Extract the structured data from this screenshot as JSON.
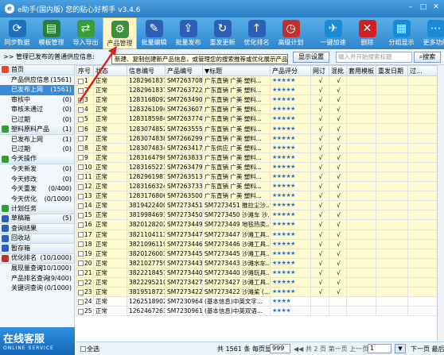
{
  "window": {
    "title": "e助手(国内版) 您的贴心好帮手 v3.4.6",
    "min": "–",
    "max": "□",
    "close": "✕"
  },
  "toolbar": [
    {
      "label": "同步数据",
      "color": "#1d6fc0",
      "glyph": "⟳"
    },
    {
      "label": "模板管理",
      "color": "#2a7d3a",
      "glyph": "▤"
    },
    {
      "label": "导入导出",
      "color": "#3a9b3a",
      "glyph": "⇄"
    },
    {
      "label": "产品管理",
      "color": "#3c8f3c",
      "glyph": "⚙"
    },
    {
      "label": "批量编辑",
      "color": "#2d5fb8",
      "glyph": "✎"
    },
    {
      "label": "批量发布",
      "color": "#2d5fb8",
      "glyph": "⇪"
    },
    {
      "label": "重发更新",
      "color": "#2d5fb8",
      "glyph": "↻"
    },
    {
      "label": "优化排名",
      "color": "#2d5fb8",
      "glyph": "↑"
    },
    {
      "label": "高级计划",
      "color": "#c03030",
      "glyph": "◷"
    },
    {
      "label": "一键加速",
      "color": "#1a8ad6",
      "glyph": "✈"
    },
    {
      "label": "删除",
      "color": "#d02020",
      "glyph": "✕"
    },
    {
      "label": "分组显示",
      "color": "#1a8ad6",
      "glyph": "▦"
    },
    {
      "label": "更多功能",
      "color": "#1a8ad6",
      "glyph": "⋯"
    }
  ],
  "infobar": {
    "text": ">> 管理已发布的普通供应信息:",
    "show_settings": "显示设置",
    "search_placeholder": "输入并开始搜索标题",
    "search_button": "搜索"
  },
  "tooltip": "新建、复制创建新产品信息，或管理您的搜索推荐或优化展示产品信息",
  "sidebar": [
    {
      "label": "首页",
      "type": "group",
      "count": "",
      "color": "#e24a2a"
    },
    {
      "label": "产品供应信息",
      "type": "sub",
      "count": "(1561)"
    },
    {
      "label": "已发布上网",
      "type": "sub",
      "count": "(1561)",
      "selected": true
    },
    {
      "label": "审核中",
      "type": "sub",
      "count": "(0)"
    },
    {
      "label": "审核未通过",
      "type": "sub",
      "count": "(0)"
    },
    {
      "label": "已过期",
      "type": "sub",
      "count": "(0)"
    },
    {
      "label": "塑料原料产品",
      "type": "group",
      "count": "(1)",
      "color": "#3a9b3a"
    },
    {
      "label": "已发布上网",
      "type": "sub",
      "count": "(1)"
    },
    {
      "label": "已过期",
      "type": "sub",
      "count": "(0)"
    },
    {
      "label": "今天操作",
      "type": "group",
      "count": "",
      "color": "#3a9b3a"
    },
    {
      "label": "今天新发",
      "type": "sub",
      "count": "(0)"
    },
    {
      "label": "今天修改",
      "type": "sub",
      "count": "(0)"
    },
    {
      "label": "今天重发",
      "type": "sub",
      "count": "(0/400)"
    },
    {
      "label": "今天优化",
      "type": "sub",
      "count": "(0/1000)"
    },
    {
      "label": "计划任务",
      "type": "group",
      "count": "",
      "color": "#3a9b3a"
    },
    {
      "label": "草稿箱",
      "type": "group",
      "count": "(5)",
      "color": "#2d5fb8"
    },
    {
      "label": "查询结果",
      "type": "group",
      "count": "",
      "color": "#2d5fb8"
    },
    {
      "label": "回收站",
      "type": "group",
      "count": "",
      "color": "#2d5fb8"
    },
    {
      "label": "暂存箱",
      "type": "group",
      "count": "",
      "color": "#2d5fb8"
    },
    {
      "label": "优化排名",
      "type": "group",
      "count": "(10/1000)",
      "color": "#c03030"
    },
    {
      "label": "展现量查询",
      "type": "sub",
      "count": "(10/1000)"
    },
    {
      "label": "产品排名查询",
      "type": "sub",
      "count": "(9/400)"
    },
    {
      "label": "关键词查询",
      "type": "sub",
      "count": "(0/1000)"
    }
  ],
  "online": {
    "title": "在线客服",
    "sub": "ONLINE SERVICE"
  },
  "grid": {
    "headers": [
      "序号",
      "状态",
      "信息编号",
      "产品编号",
      "▼标题",
      "产品评分",
      "网订",
      "混批",
      "套用模板",
      "重发日期",
      "过..."
    ],
    "rows": [
      [
        "1",
        "正常",
        "1282961837",
        "SM7263708",
        "广东直销 广美 塑料...",
        "★★★★★",
        "√",
        "√"
      ],
      [
        "2",
        "正常",
        "1282961837",
        "SM7263722",
        "广东直销 广美 塑料...",
        "★★★★★",
        "√",
        "√"
      ],
      [
        "3",
        "正常",
        "1283168092",
        "SM7263490",
        "广东直销 广美 塑料...",
        "★★★★★",
        "√",
        "√"
      ],
      [
        "4",
        "正常",
        "1283261094",
        "SM7263607",
        "广东直销 广美 塑料...",
        "★★★★★",
        "√",
        "√"
      ],
      [
        "5",
        "正常",
        "1283185984",
        "SM7263774",
        "广东直销 广美 塑料...",
        "★★★★★",
        "√",
        "√"
      ],
      [
        "6",
        "正常",
        "1283074852",
        "SM7263555",
        "广东直销 广美 塑料...",
        "★★★★★",
        "√",
        "√"
      ],
      [
        "7",
        "正常",
        "1283074838",
        "SM7266299",
        "广东直销 广美 塑料...",
        "★★★★★",
        "√",
        "√"
      ],
      [
        "8",
        "正常",
        "1283074834",
        "SM7263417",
        "广东供应 广美 塑料...",
        "★★★★★",
        "√",
        "√"
      ],
      [
        "9",
        "正常",
        "1283164798",
        "SM7263833",
        "广东直销 广美 塑料...",
        "★★★★★",
        "√",
        "√"
      ],
      [
        "10",
        "正常",
        "1283165221",
        "SM7263479",
        "广东直销 广美 塑料...",
        "★★★★★",
        "√",
        "√"
      ],
      [
        "11",
        "正常",
        "1282961987",
        "SM7263513",
        "广东直销 广美 塑料...",
        "★★★★★",
        "√",
        "√"
      ],
      [
        "12",
        "正常",
        "1283166324",
        "SM7263733",
        "广东直销 广美 塑料...",
        "★★★★★",
        "√",
        "√"
      ],
      [
        "13",
        "正常",
        "1283176806",
        "SM7263500",
        "广东直销 广美 塑料...",
        "★★★★★",
        "√",
        "√"
      ],
      [
        "14",
        "正常",
        "38194224000",
        "SM7273451",
        "SM7273451  推拉尘沙...",
        "★★★★★",
        "√",
        "√"
      ],
      [
        "15",
        "正常",
        "38199846930",
        "SM7273450",
        "SM7273450  沙滩车 沙...",
        "★★★★★",
        "√",
        "√"
      ],
      [
        "16",
        "正常",
        "38201282021",
        "SM7273449",
        "SM7273449  地毯热卖...",
        "★★★★★",
        "√",
        "√"
      ],
      [
        "17",
        "正常",
        "38211041130",
        "SM7273447",
        "SM7273447  沙滩工具...",
        "★★★★★",
        "√",
        "√"
      ],
      [
        "18",
        "正常",
        "38210961191",
        "SM7273446",
        "SM7273446  沙滩工具...",
        "★★★★★",
        "√",
        "√"
      ],
      [
        "19",
        "正常",
        "38201260034",
        "SM7273445",
        "SM7273445  沙滩工具...",
        "★★★★★",
        "√",
        "√"
      ],
      [
        "20",
        "正常",
        "38210277592",
        "SM7273443",
        "SM7273443  沙滩水车...",
        "★★★★★",
        "√",
        "√"
      ],
      [
        "21",
        "正常",
        "38222184577",
        "SM7273440",
        "SM7273440  沙滩玩具...",
        "★★★★★",
        "√",
        "√"
      ],
      [
        "22",
        "正常",
        "38222952102",
        "SM7273427",
        "SM7273427  沙滩工具...",
        "★★★★★",
        "√",
        "√"
      ],
      [
        "23",
        "正常",
        "38195187279",
        "SM7273422",
        "SM7273422  沙滩桨 (...",
        "★★★★★",
        "√",
        "√"
      ],
      [
        "24",
        "正常",
        "1262518902",
        "SM7230964",
        "(基本信息)中英文字...",
        "★★★★",
        "",
        ""
      ],
      [
        "25",
        "正常",
        "1262467263",
        "SM7230961",
        "(基本信息)中英双语...",
        "★★★★",
        "",
        ""
      ]
    ]
  },
  "footer": {
    "select_all": "全选",
    "page_info": "共 1561 条  每页显示",
    "page_size": "999",
    "nav": "◀◀ 共 2 页  第一页  上一页  第1页",
    "page_input": "1",
    "go": "▼",
    "next": "下一页  最后一页"
  }
}
